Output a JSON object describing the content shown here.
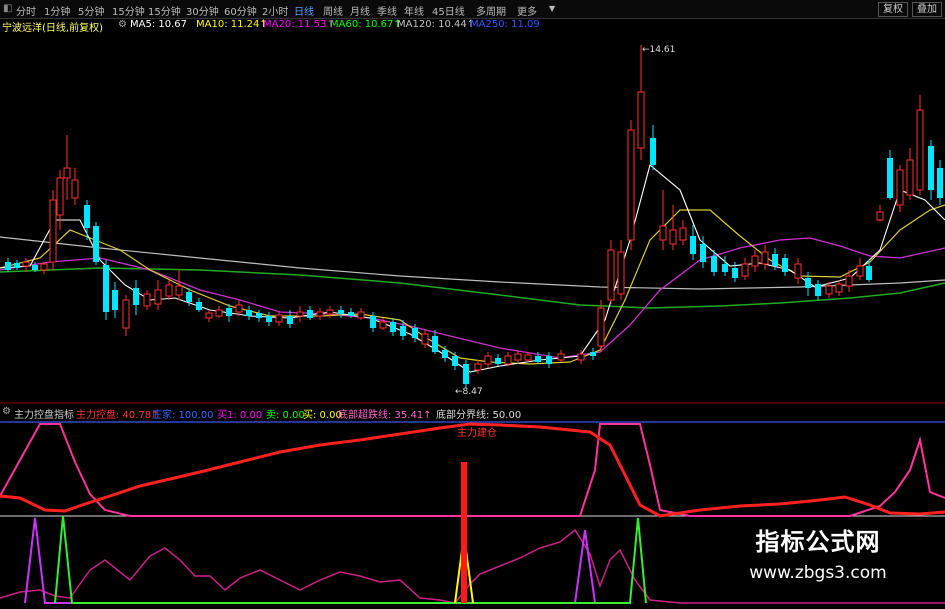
{
  "toolbar": {
    "icon": "dock-icon",
    "periods": [
      "分时",
      "1分钟",
      "5分钟",
      "15分钟",
      "15分钟",
      "30分钟",
      "60分钟",
      "2小时",
      "日线",
      "周线",
      "月线",
      "季线",
      "年线",
      "45日线",
      "多周期",
      "更多"
    ],
    "active_period": "日线",
    "right_buttons": [
      "复权",
      "叠加"
    ]
  },
  "ma_line": {
    "title": "宁波远洋(日线,前复权)",
    "items": [
      {
        "label": "MA5: 10.67",
        "color": "#ffffff"
      },
      {
        "label": "MA10: 11.24↑",
        "color": "#ffff00"
      },
      {
        "label": "MA20: 11.53↑",
        "color": "#ff00ff"
      },
      {
        "label": "MA60: 10.67↑",
        "color": "#00ff00"
      },
      {
        "label": "MA120: 10.44↑",
        "color": "#c0c0c0"
      },
      {
        "label": "MA250: 11.09",
        "color": "#3355ff"
      }
    ]
  },
  "price_labels": {
    "high": "14.61",
    "low": "8.47"
  },
  "indicator": {
    "title": "主力控盘指标",
    "items": [
      {
        "label": "主力控盘: 40.78↑",
        "color": "#ff3333"
      },
      {
        "label": "庄家: 100.00",
        "color": "#3366ff"
      },
      {
        "label": "买1: 0.00",
        "color": "#ff00ff"
      },
      {
        "label": "卖: 0.00",
        "color": "#00ff00"
      },
      {
        "label": "买: 0.00",
        "color": "#ffff00"
      },
      {
        "label": "底部超跌线: 35.41↑",
        "color": "#ff66cc"
      },
      {
        "label": "底部分界线: 50.00",
        "color": "#dddddd"
      }
    ],
    "annotation": "主力建仓"
  },
  "watermark": {
    "line1": "指标公式网",
    "line2": "www.zbgs3.com"
  },
  "colors": {
    "up": "#ff3030",
    "down": "#00e5ff",
    "background": "#000000"
  }
}
